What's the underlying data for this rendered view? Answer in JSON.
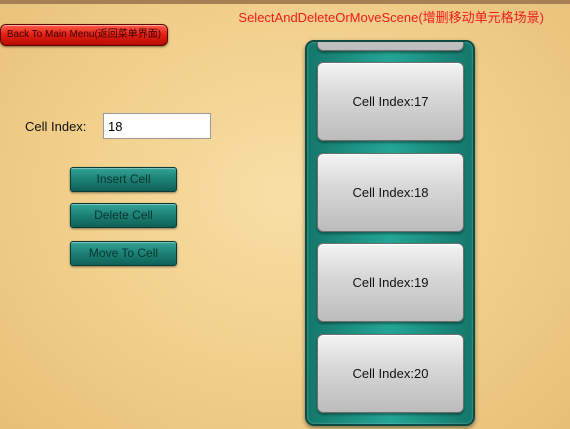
{
  "scene_title": "SelectAndDeleteOrMoveScene(增删移动单元格场景)",
  "back_button": "Back To Main Menu(返回菜单界面)",
  "cell_index": {
    "label": "Cell Index:",
    "value": "18"
  },
  "buttons": {
    "insert": "Insert Cell",
    "delete": "Delete Cell",
    "move": "Move To Cell"
  },
  "cells": [
    {
      "label": ""
    },
    {
      "label": "Cell Index:17"
    },
    {
      "label": "Cell Index:18"
    },
    {
      "label": "Cell Index:19"
    },
    {
      "label": "Cell Index:20"
    }
  ]
}
